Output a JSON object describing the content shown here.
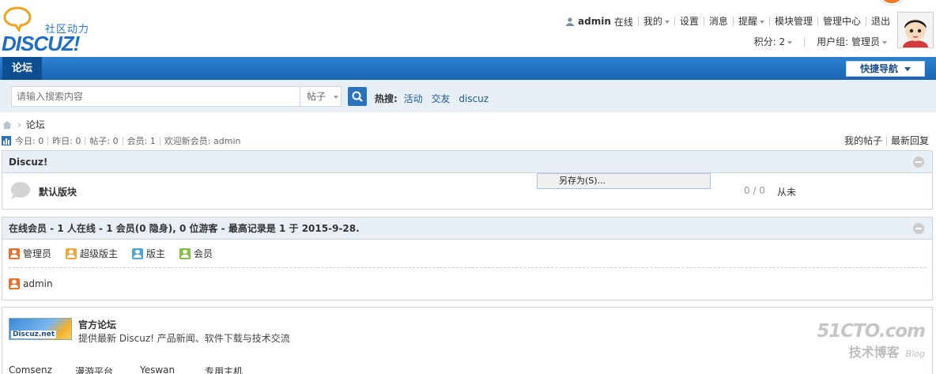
{
  "logo": {
    "cn": "社区动力",
    "en": "DISCUZ!"
  },
  "topbar": {
    "username": "admin",
    "online": "在线",
    "my": "我的",
    "settings": "设置",
    "messages": "消息",
    "reminders": "提醒",
    "module_mgmt": "模块管理",
    "admin_center": "管理中心",
    "logout": "退出"
  },
  "subbar": {
    "points": "积分: 2",
    "usergroup": "用户组: 管理员"
  },
  "nav": {
    "tab": "论坛",
    "quick_nav": "快捷导航"
  },
  "search": {
    "placeholder": "请输入搜索内容",
    "type": "帖子",
    "hot_label": "热搜:",
    "hot_keywords": [
      "活动",
      "交友",
      "discuz"
    ]
  },
  "breadcrumb": {
    "current": "论坛"
  },
  "stats": {
    "today": "今日: 0",
    "yesterday": "昨日: 0",
    "posts": "帖子: 0",
    "members": "会员: 1",
    "welcome": "欢迎新会员: admin",
    "my_posts": "我的帖子",
    "latest_replies": "最新回复"
  },
  "category": {
    "title": "Discuz!",
    "forum_name": "默认版块",
    "counts": "0 / 0",
    "last_post": "从未"
  },
  "context_menu": {
    "save_as": "另存为(S)..."
  },
  "online": {
    "title": "在线会员 - 1 人在线 - 1 会员(0 隐身), 0 位游客 - 最高记录是 1 于 2015-9-28.",
    "legend": [
      {
        "label": "管理员",
        "color": "#e8702a"
      },
      {
        "label": "超级版主",
        "color": "#f0a53a"
      },
      {
        "label": "版主",
        "color": "#4aa6dc"
      },
      {
        "label": "会员",
        "color": "#86c240"
      }
    ],
    "users": [
      {
        "name": "admin",
        "color": "#e8702a"
      }
    ]
  },
  "partner": {
    "logo_text": "Discuz.net",
    "title": "官方论坛",
    "desc": "提供最新 Discuz! 产品新闻、软件下载与技术交流",
    "links": [
      "Comsenz",
      "漫游平台",
      "Yeswan",
      "专用主机"
    ]
  },
  "watermark": {
    "line1": "51CTO.com",
    "line2": "技术博客",
    "line3": "Blog"
  }
}
